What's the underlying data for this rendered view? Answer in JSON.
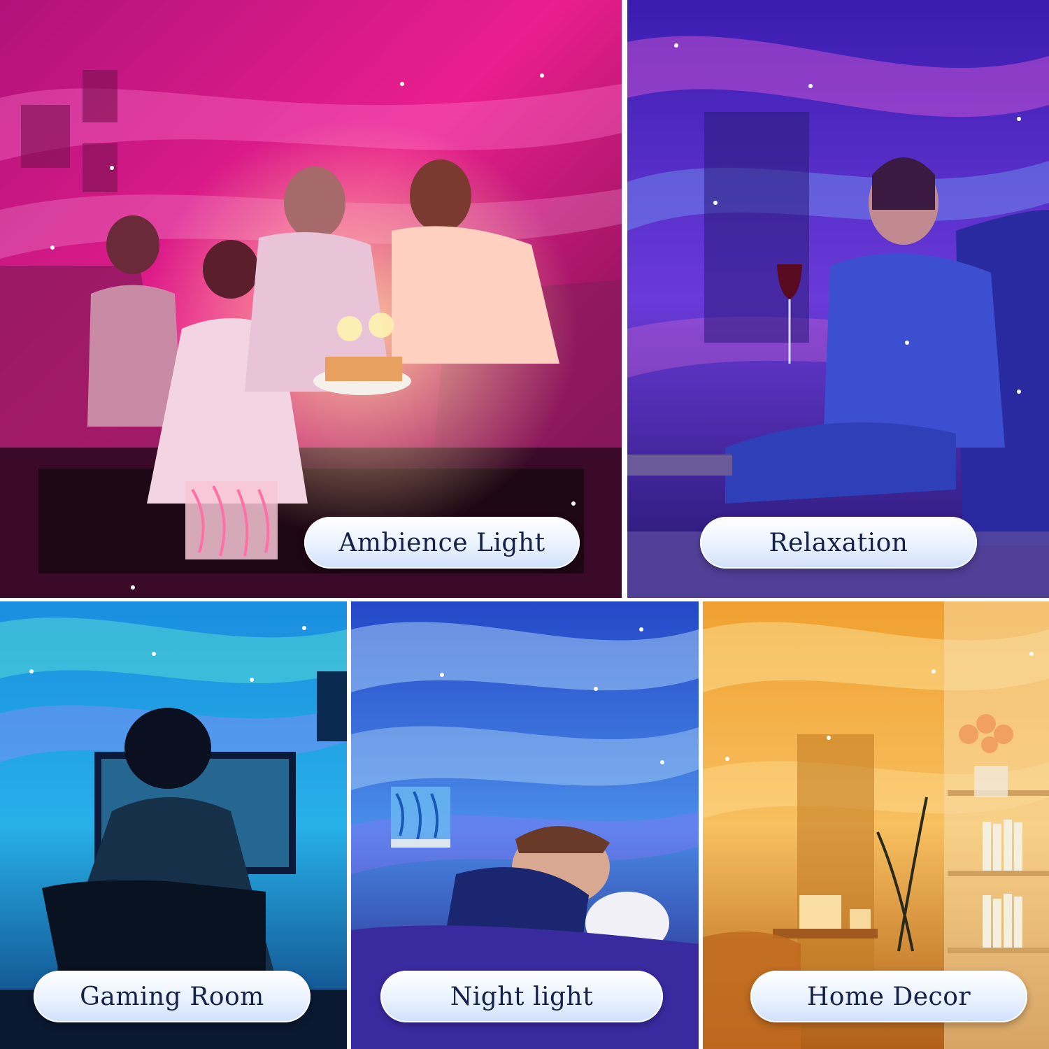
{
  "panels": [
    {
      "label": "Ambience Light"
    },
    {
      "label": "Relaxation"
    },
    {
      "label": "Gaming Room"
    },
    {
      "label": "Night light"
    },
    {
      "label": "Home Decor"
    }
  ],
  "colors": {
    "label_text": "#14214a",
    "pill_bg": "#eaf2ff",
    "ambience_tone": "#e0228c",
    "relaxation_tone": "#5a3fd6",
    "gaming_tone": "#1fa6e6",
    "night_tone": "#2f6fe0",
    "home_decor_tone": "#f0a030"
  }
}
